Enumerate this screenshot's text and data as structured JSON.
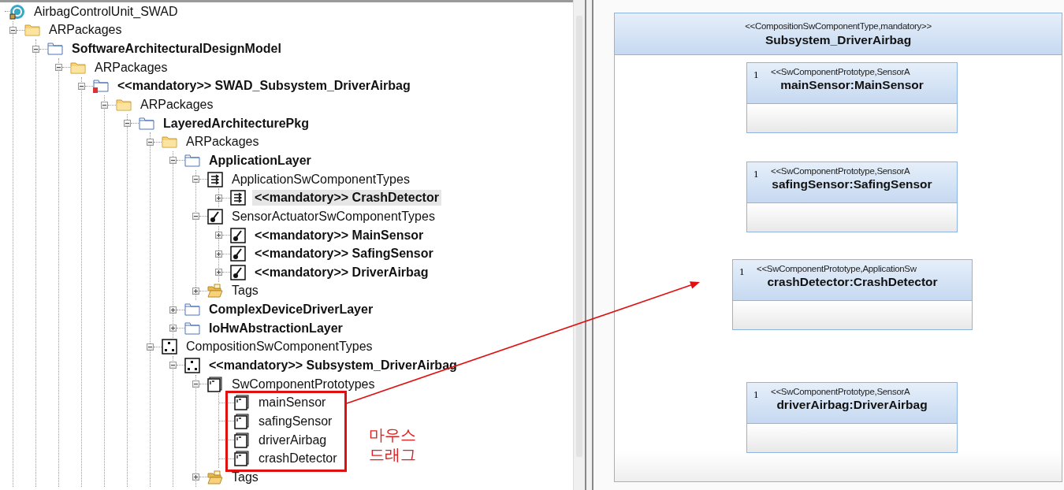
{
  "tree": [
    {
      "label": "AirbagControlUnit_SWAD",
      "kind": "app",
      "bold": false,
      "selected": false,
      "children": [
        {
          "label": "ARPackages",
          "kind": "folder",
          "bold": false,
          "selected": false,
          "expanded": true,
          "children": [
            {
              "label": "SoftwareArchitecturalDesignModel",
              "kind": "package",
              "bold": true,
              "selected": false,
              "expanded": true,
              "children": [
                {
                  "label": "ARPackages",
                  "kind": "folder",
                  "bold": false,
                  "selected": false,
                  "expanded": true,
                  "children": [
                    {
                      "label": "<<mandatory>> SWAD_Subsystem_DriverAirbag",
                      "kind": "mandatory-package",
                      "bold": true,
                      "selected": false,
                      "expanded": true,
                      "children": [
                        {
                          "label": "ARPackages",
                          "kind": "folder",
                          "bold": false,
                          "selected": false,
                          "expanded": true,
                          "children": [
                            {
                              "label": "LayeredArchitecturePkg",
                              "kind": "package",
                              "bold": true,
                              "selected": false,
                              "expanded": true,
                              "children": [
                                {
                                  "label": "ARPackages",
                                  "kind": "folder",
                                  "bold": false,
                                  "selected": false,
                                  "expanded": true,
                                  "children": [
                                    {
                                      "label": "ApplicationLayer",
                                      "kind": "package",
                                      "bold": true,
                                      "selected": false,
                                      "expanded": true,
                                      "children": [
                                        {
                                          "label": "ApplicationSwComponentTypes",
                                          "kind": "component-types",
                                          "bold": false,
                                          "selected": false,
                                          "expanded": true,
                                          "children": [
                                            {
                                              "label": "<<mandatory>> CrashDetector",
                                              "kind": "component-types",
                                              "bold": true,
                                              "selected": true,
                                              "expanded": false
                                            }
                                          ]
                                        },
                                        {
                                          "label": "SensorActuatorSwComponentTypes",
                                          "kind": "sensor-actuator",
                                          "bold": false,
                                          "selected": false,
                                          "expanded": true,
                                          "children": [
                                            {
                                              "label": "<<mandatory>> MainSensor",
                                              "kind": "sensor-actuator",
                                              "bold": true,
                                              "selected": false,
                                              "expanded": false
                                            },
                                            {
                                              "label": "<<mandatory>> SafingSensor",
                                              "kind": "sensor-actuator",
                                              "bold": true,
                                              "selected": false,
                                              "expanded": false
                                            },
                                            {
                                              "label": "<<mandatory>> DriverAirbag",
                                              "kind": "sensor-actuator",
                                              "bold": true,
                                              "selected": false,
                                              "expanded": false
                                            }
                                          ]
                                        },
                                        {
                                          "label": "Tags",
                                          "kind": "tags",
                                          "bold": false,
                                          "selected": false,
                                          "expanded": false
                                        }
                                      ]
                                    },
                                    {
                                      "label": "ComplexDeviceDriverLayer",
                                      "kind": "package",
                                      "bold": true,
                                      "selected": false,
                                      "expanded": false
                                    },
                                    {
                                      "label": "IoHwAbstractionLayer",
                                      "kind": "package",
                                      "bold": true,
                                      "selected": false,
                                      "expanded": false
                                    }
                                  ]
                                },
                                {
                                  "label": "CompositionSwComponentTypes",
                                  "kind": "composition",
                                  "bold": false,
                                  "selected": false,
                                  "expanded": true,
                                  "children": [
                                    {
                                      "label": "<<mandatory>> Subsystem_DriverAirbag",
                                      "kind": "composition",
                                      "bold": true,
                                      "selected": false,
                                      "expanded": true,
                                      "children": [
                                        {
                                          "label": "SwComponentPrototypes",
                                          "kind": "prototype",
                                          "bold": false,
                                          "selected": false,
                                          "expanded": true,
                                          "children": [
                                            {
                                              "label": "mainSensor",
                                              "kind": "prototype",
                                              "bold": false,
                                              "selected": false
                                            },
                                            {
                                              "label": "safingSensor",
                                              "kind": "prototype",
                                              "bold": false,
                                              "selected": false
                                            },
                                            {
                                              "label": "driverAirbag",
                                              "kind": "prototype",
                                              "bold": false,
                                              "selected": false
                                            },
                                            {
                                              "label": "crashDetector",
                                              "kind": "prototype",
                                              "bold": false,
                                              "selected": false
                                            }
                                          ]
                                        },
                                        {
                                          "label": "Tags",
                                          "kind": "tags",
                                          "bold": false,
                                          "selected": false,
                                          "expanded": false
                                        }
                                      ]
                                    }
                                  ]
                                }
                              ]
                            }
                          ]
                        }
                      ]
                    }
                  ]
                }
              ]
            }
          ]
        }
      ]
    }
  ],
  "annotation": {
    "lines": [
      "마우스",
      "드래그"
    ]
  },
  "diagram": {
    "stereotype": "<<CompositionSwComponentType,mandatory>>",
    "name": "Subsystem_DriverAirbag",
    "parts": [
      {
        "multiplicity": "1",
        "stereotype": "<<SwComponentPrototype,SensorA",
        "name": "mainSensor:MainSensor"
      },
      {
        "multiplicity": "1",
        "stereotype": "<<SwComponentPrototype,SensorA",
        "name": "safingSensor:SafingSensor"
      },
      {
        "multiplicity": "1",
        "stereotype": "<<SwComponentPrototype,ApplicationSw",
        "name": "crashDetector:CrashDetector"
      },
      {
        "multiplicity": "1",
        "stereotype": "<<SwComponentPrototype,SensorA",
        "name": "driverAirbag:DriverAirbag"
      }
    ]
  }
}
